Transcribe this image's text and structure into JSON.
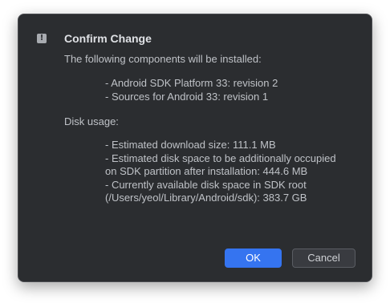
{
  "dialog": {
    "icon": "warning-icon",
    "icon_glyph": "!",
    "title": "Confirm Change",
    "intro": "The following components will be installed:",
    "components": [
      "- Android SDK Platform 33: revision 2",
      "- Sources for Android 33: revision 1"
    ],
    "disk_label": "Disk usage:",
    "disk_details": [
      "- Estimated download size: 111.1 MB",
      "- Estimated disk space to be additionally occupied on SDK partition after installation: 444.6 MB",
      "- Currently available disk space in SDK root (/Users/yeol/Library/Android/sdk): 383.7 GB"
    ]
  },
  "buttons": {
    "ok_label": "OK",
    "cancel_label": "Cancel"
  },
  "colors": {
    "dialog_background": "#2b2d30",
    "primary_button": "#3574f0",
    "text": "#bfc2c7",
    "title_text": "#dfe1e5"
  }
}
